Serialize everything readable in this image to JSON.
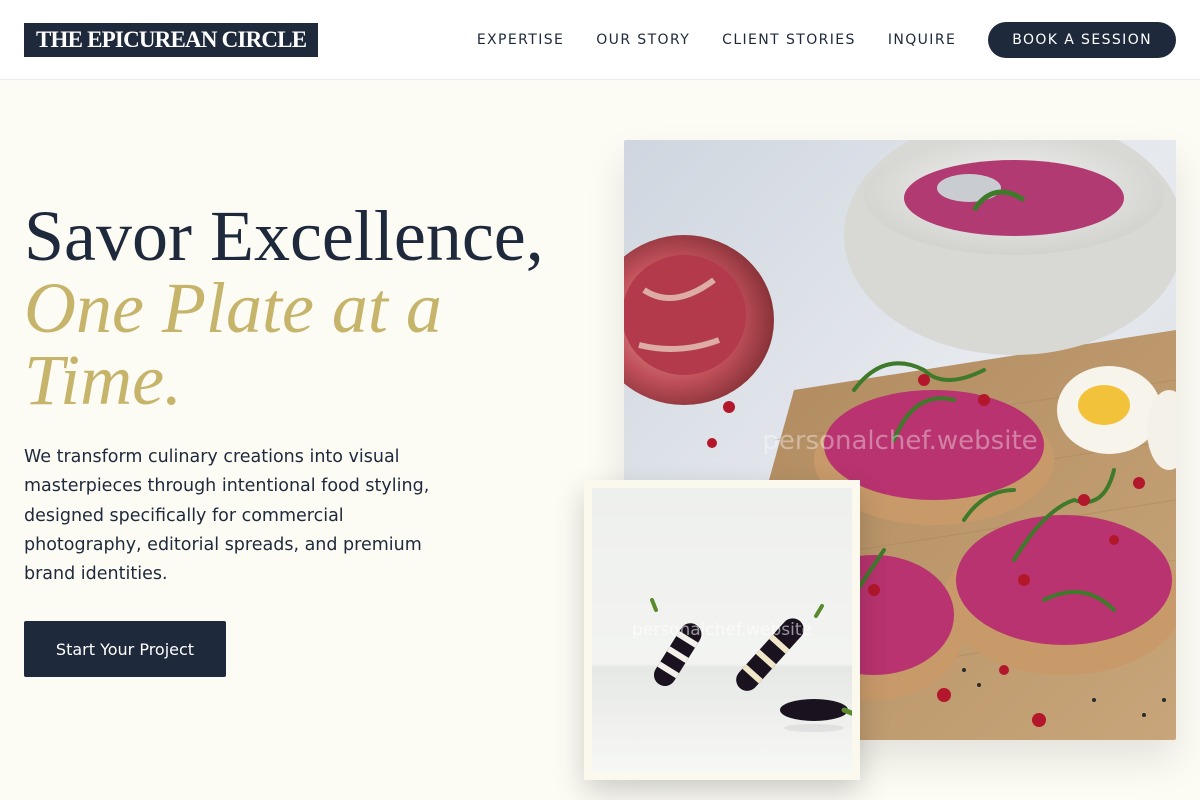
{
  "header": {
    "logo": "THE EPICUREAN CIRCLE",
    "nav": [
      "EXPERTISE",
      "OUR STORY",
      "CLIENT STORIES",
      "INQUIRE"
    ],
    "cta": "BOOK A SESSION"
  },
  "hero": {
    "headline_line1": "Savor Excellence,",
    "headline_line2": "One Plate at a Time.",
    "lead": "We transform culinary creations into visual masterpieces through intentional food styling, designed specifically for commercial photography, editorial spreads, and premium brand identities.",
    "button": "Start Your Project"
  },
  "images": {
    "main": {
      "subject": "beetroot toasts with arugula, pomegranate and boiled eggs on a wooden board",
      "watermark": "personalchef.website"
    },
    "secondary": {
      "subject": "sliced eggplants on a white surface",
      "watermark": "personalchef.website"
    }
  },
  "colors": {
    "navy": "#1e293b",
    "gold": "#c6b46a",
    "background": "#fcfbf4",
    "header": "#ffffff"
  }
}
